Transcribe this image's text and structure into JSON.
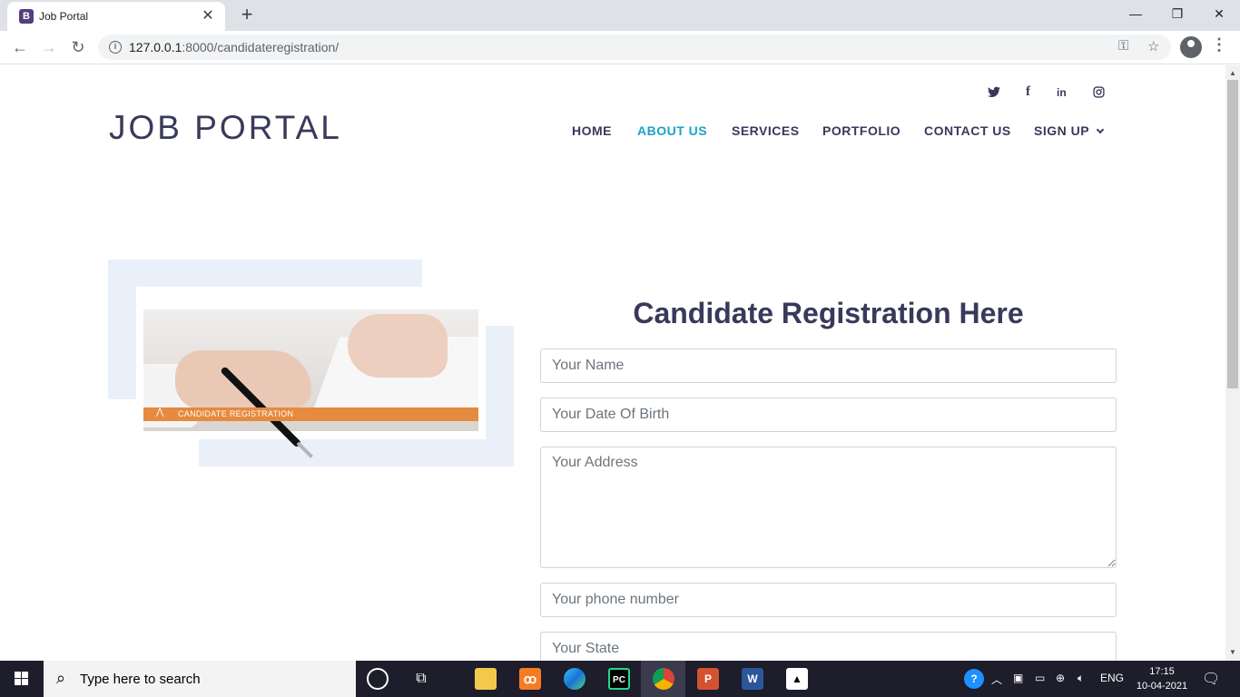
{
  "browser": {
    "tab_favicon": "B",
    "tab_title": "Job Portal",
    "url_host": "127.0.0.1",
    "url_rest": ":8000/candidateregistration/",
    "window_controls": [
      "—",
      "❐",
      "✕"
    ]
  },
  "site": {
    "logo": "JOB PORTAL",
    "social_icons": [
      "twitter-icon",
      "facebook-icon",
      "linkedin-icon",
      "instagram-icon"
    ],
    "nav": {
      "home": "HOME",
      "about": "ABOUT US",
      "services": "SERVICES",
      "portfolio": "PORTFOLIO",
      "contact": "CONTACT US",
      "signup": "SIGN UP"
    },
    "active_nav": "ABOUT US",
    "accent_color": "#1aa3c8",
    "text_color": "#39395b"
  },
  "hero_image": {
    "caption": "CANDIDATE REGISTRATION",
    "mark": "⋀"
  },
  "form": {
    "title": "Candidate Registration Here",
    "name_placeholder": "Your Name",
    "dob_placeholder": "Your Date Of Birth",
    "address_placeholder": "Your Address",
    "phone_placeholder": "Your phone number",
    "state_placeholder": "Your State"
  },
  "taskbar": {
    "search_placeholder": "Type here to search",
    "language": "ENG",
    "time": "17:15",
    "date": "10-04-2021"
  }
}
